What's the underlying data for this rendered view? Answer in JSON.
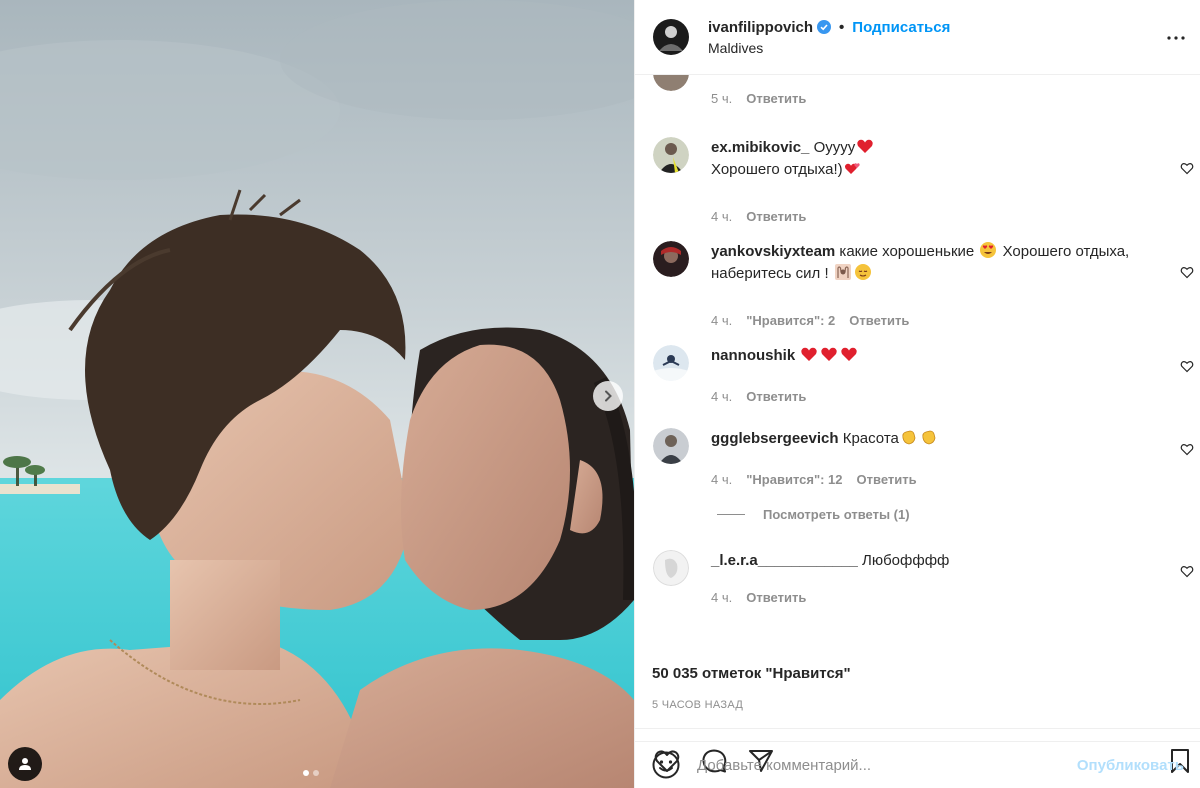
{
  "photo": {
    "dots": [
      true,
      false
    ]
  },
  "header": {
    "username": "ivanfilippovich",
    "separator": "•",
    "follow_label": "Подписаться",
    "location": "Maldives"
  },
  "comments": [
    {
      "username": "",
      "text": "",
      "time": "5 ч.",
      "likes": "",
      "reply_label": "Ответить"
    },
    {
      "username": "ex.mibikovic_",
      "text": "Oyyyy",
      "text2": "Хорошего отдыха!)",
      "time": "4 ч.",
      "likes": "",
      "reply_label": "Ответить",
      "emojis": [
        "red-heart-emoji",
        "two-hearts-emoji"
      ]
    },
    {
      "username": "yankovskiyxteam",
      "text": "какие хорошенькие",
      "text_b": "Хорошего отдыха,",
      "text2": "наберитесь сил !",
      "time": "4 ч.",
      "likes": "\"Нравится\": 2",
      "reply_label": "Ответить",
      "emojis": [
        "heart-eyes-emoji",
        "raising-hands-emoji",
        "relieved-face-emoji"
      ]
    },
    {
      "username": "nannoushik",
      "text": "",
      "time": "4 ч.",
      "likes": "",
      "reply_label": "Ответить",
      "emojis": [
        "red-heart-emoji",
        "red-heart-emoji",
        "red-heart-emoji"
      ]
    },
    {
      "username": "ggglebsergeevich",
      "text": "Красота",
      "time": "4 ч.",
      "likes": "\"Нравится\": 12",
      "reply_label": "Ответить",
      "emojis": [
        "clapping-hands-emoji",
        "clapping-hands-emoji"
      ]
    },
    {
      "username": "_l.e.r.a____________",
      "text": "Любофффф",
      "time": "4 ч.",
      "likes": "",
      "reply_label": "Ответить"
    }
  ],
  "view_replies_label": "Посмотреть ответы (1)",
  "likes_count": "50 035 отметок \"Нравится\"",
  "time_ago": "5 ЧАСОВ НАЗАД",
  "add_comment": {
    "placeholder": "Добавьте комментарий...",
    "publish_label": "Опубликовать"
  },
  "colors": {
    "accent": "#0095f6",
    "publish_disabled": "#b2dffc",
    "secondary_text": "#8e8e8e",
    "heart_red": "#ed4956"
  }
}
